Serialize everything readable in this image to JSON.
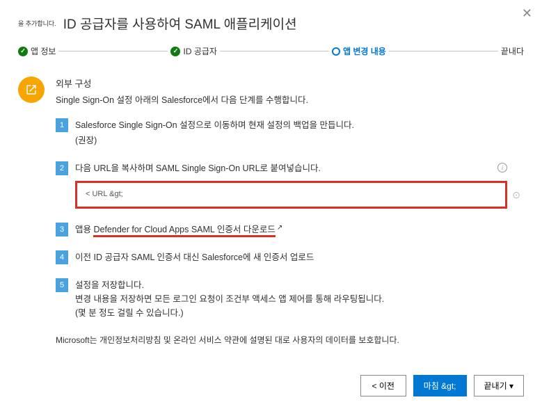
{
  "close_label": "✕",
  "header": {
    "prefix": "을 추가합니다.",
    "title": "ID 공급자를 사용하여 SAML 애플리케이션"
  },
  "stepper": {
    "step1": "앱 정보",
    "step2": "ID 공급자",
    "step3": "앱 변경 내용",
    "step4": "끝내다"
  },
  "section": {
    "title": "외부 구성",
    "desc": "Single Sign-On 설정 아래의 Salesforce에서 다음 단계를 수행합니다."
  },
  "steps": {
    "s1": {
      "num": "1",
      "text": "Salesforce Single Sign-On 설정으로 이동하며 현재 설정의 백업을 만듭니다.",
      "rec": "(권장)"
    },
    "s2": {
      "num": "2",
      "text": "다음 URL을 복사하며 SAML Single Sign-On URL로 붙여넣습니다.",
      "url": "< URL &gt;",
      "info": "i"
    },
    "s3": {
      "num": "3",
      "text_prefix": "앱용 ",
      "text_link": "Defender for Cloud Apps SAML 인증서 다운로드",
      "ext": "↗"
    },
    "s4": {
      "num": "4",
      "text": "이전 ID 공급자 SAML 인증서 대신 Salesforce에 새 인증서 업로드"
    },
    "s5": {
      "num": "5",
      "line1": "설정을 저장합니다.",
      "line2": "변경 내용을 저장하면 모든 로그인 요청이 조건부 액세스 앱 제어를 통해 라우팅됩니다.",
      "line3": "(몇 분 정도 걸릴 수 있습니다.)"
    }
  },
  "footnote": "Microsoft는 개인정보처리방침 및 온라인 서비스 약관에 설명된 대로 사용자의 데이터를 보호합니다.",
  "footer": {
    "prev": "< 이전",
    "finish": "마침 &gt;",
    "export": "끝내기 ▾"
  }
}
